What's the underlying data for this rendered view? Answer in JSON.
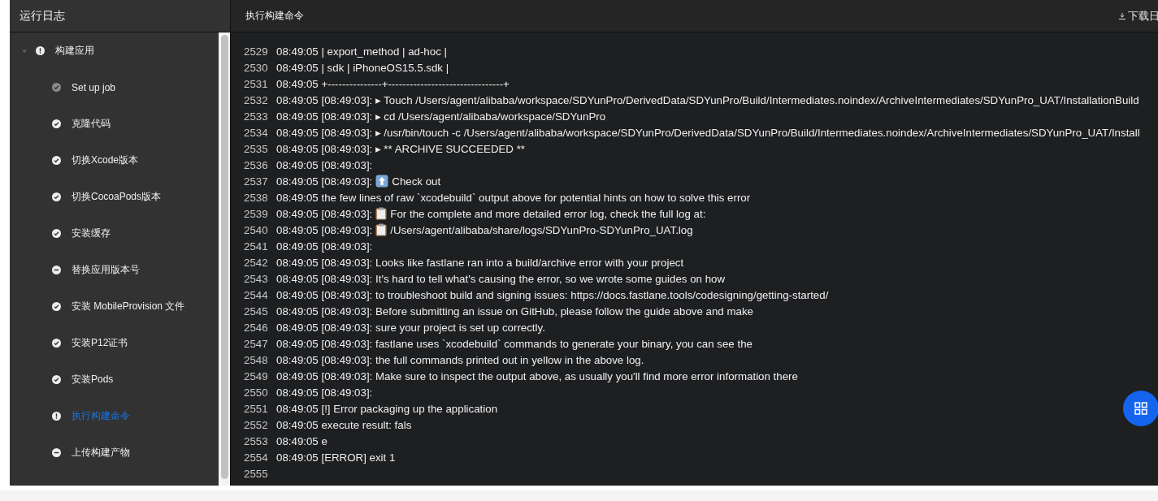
{
  "sidebar": {
    "title": "运行日志",
    "tree": [
      {
        "label": "构建应用",
        "kind": "warning",
        "expanded": true,
        "selected": false,
        "children": [
          {
            "label": "Set up job",
            "kind": "pending",
            "selected": false
          },
          {
            "label": "克隆代码",
            "kind": "success",
            "selected": false
          },
          {
            "label": "切换Xcode版本",
            "kind": "success",
            "selected": false
          },
          {
            "label": "切换CocoaPods版本",
            "kind": "success",
            "selected": false
          },
          {
            "label": "安装缓存",
            "kind": "success",
            "selected": false
          },
          {
            "label": "替换应用版本号",
            "kind": "skipped",
            "selected": false
          },
          {
            "label": "安装 MobileProvision 文件",
            "kind": "success",
            "selected": false
          },
          {
            "label": "安装P12证书",
            "kind": "success",
            "selected": false
          },
          {
            "label": "安装Pods",
            "kind": "success",
            "selected": false
          },
          {
            "label": "执行构建命令",
            "kind": "warning",
            "selected": true
          },
          {
            "label": "上传构建产物",
            "kind": "skipped",
            "selected": false
          }
        ]
      }
    ]
  },
  "log": {
    "title": "执行构建命令",
    "download_label": "下载日",
    "lines": [
      {
        "number": "2529",
        "text": "08:49:05 | export_method | ad-hoc |",
        "kind": "plain"
      },
      {
        "number": "2530",
        "text": "08:49:05 | sdk | iPhoneOS15.5.sdk |",
        "kind": "plain"
      },
      {
        "number": "2531",
        "text": "08:49:05 +---------------+--------------------------------+",
        "kind": "plain"
      },
      {
        "number": "2532",
        "text": "08:49:05 [08:49:03]: ▸ Touch /Users/agent/alibaba/workspace/SDYunPro/DerivedData/SDYunPro/Build/Intermediates.noindex/ArchiveIntermediates/SDYunPro_UAT/InstallationBuild",
        "kind": "plain"
      },
      {
        "number": "2533",
        "text": "08:49:05 [08:49:03]: ▸ cd /Users/agent/alibaba/workspace/SDYunPro",
        "kind": "plain"
      },
      {
        "number": "2534",
        "text": "08:49:05 [08:49:03]: ▸ /usr/bin/touch -c /Users/agent/alibaba/workspace/SDYunPro/DerivedData/SDYunPro/Build/Intermediates.noindex/ArchiveIntermediates/SDYunPro_UAT/Install",
        "kind": "plain"
      },
      {
        "number": "2535",
        "text": "08:49:05 [08:49:03]: ▸ ** ARCHIVE SUCCEEDED **",
        "kind": "plain"
      },
      {
        "number": "2536",
        "text": "08:49:05 [08:49:03]:",
        "kind": "plain"
      },
      {
        "number": "2537",
        "text": "08:49:05 [08:49:03]:",
        "after": "Check out",
        "kind": "arrow"
      },
      {
        "number": "2538",
        "text": "08:49:05 the few lines of raw `xcodebuild` output above for potential hints on how to solve this error",
        "kind": "plain"
      },
      {
        "number": "2539",
        "text": "08:49:05 [08:49:03]:",
        "after": "For the complete and more detailed error log, check the full log at:",
        "kind": "clipboard"
      },
      {
        "number": "2540",
        "text": "08:49:05 [08:49:03]:",
        "after": "/Users/agent/alibaba/share/logs/SDYunPro-SDYunPro_UAT.log",
        "kind": "clipboard"
      },
      {
        "number": "2541",
        "text": "08:49:05 [08:49:03]:",
        "kind": "plain"
      },
      {
        "number": "2542",
        "text": "08:49:05 [08:49:03]: Looks like fastlane ran into a build/archive error with your project",
        "kind": "plain"
      },
      {
        "number": "2543",
        "text": "08:49:05 [08:49:03]: It's hard to tell what's causing the error, so we wrote some guides on how",
        "kind": "plain"
      },
      {
        "number": "2544",
        "text": "08:49:05 [08:49:03]: to troubleshoot build and signing issues: https://docs.fastlane.tools/codesigning/getting-started/",
        "kind": "plain"
      },
      {
        "number": "2545",
        "text": "08:49:05 [08:49:03]: Before submitting an issue on GitHub, please follow the guide above and make",
        "kind": "plain"
      },
      {
        "number": "2546",
        "text": "08:49:05 [08:49:03]: sure your project is set up correctly.",
        "kind": "plain"
      },
      {
        "number": "2547",
        "text": "08:49:05 [08:49:03]: fastlane uses `xcodebuild` commands to generate your binary, you can see the",
        "kind": "plain"
      },
      {
        "number": "2548",
        "text": "08:49:05 [08:49:03]: the full commands printed out in yellow in the above log.",
        "kind": "plain"
      },
      {
        "number": "2549",
        "text": "08:49:05 [08:49:03]: Make sure to inspect the output above, as usually you'll find more error information there",
        "kind": "plain"
      },
      {
        "number": "2550",
        "text": "08:49:05 [08:49:03]:",
        "kind": "plain"
      },
      {
        "number": "2551",
        "text": "08:49:05 [!] Error packaging up the application",
        "kind": "plain"
      },
      {
        "number": "2552",
        "text": "08:49:05 execute result: fals",
        "kind": "plain"
      },
      {
        "number": "2553",
        "text": "08:49:05 e",
        "kind": "plain"
      },
      {
        "number": "2554",
        "text": "08:49:05 [ERROR] exit 1",
        "kind": "plain"
      },
      {
        "number": "2555",
        "kind": "plain"
      }
    ]
  }
}
